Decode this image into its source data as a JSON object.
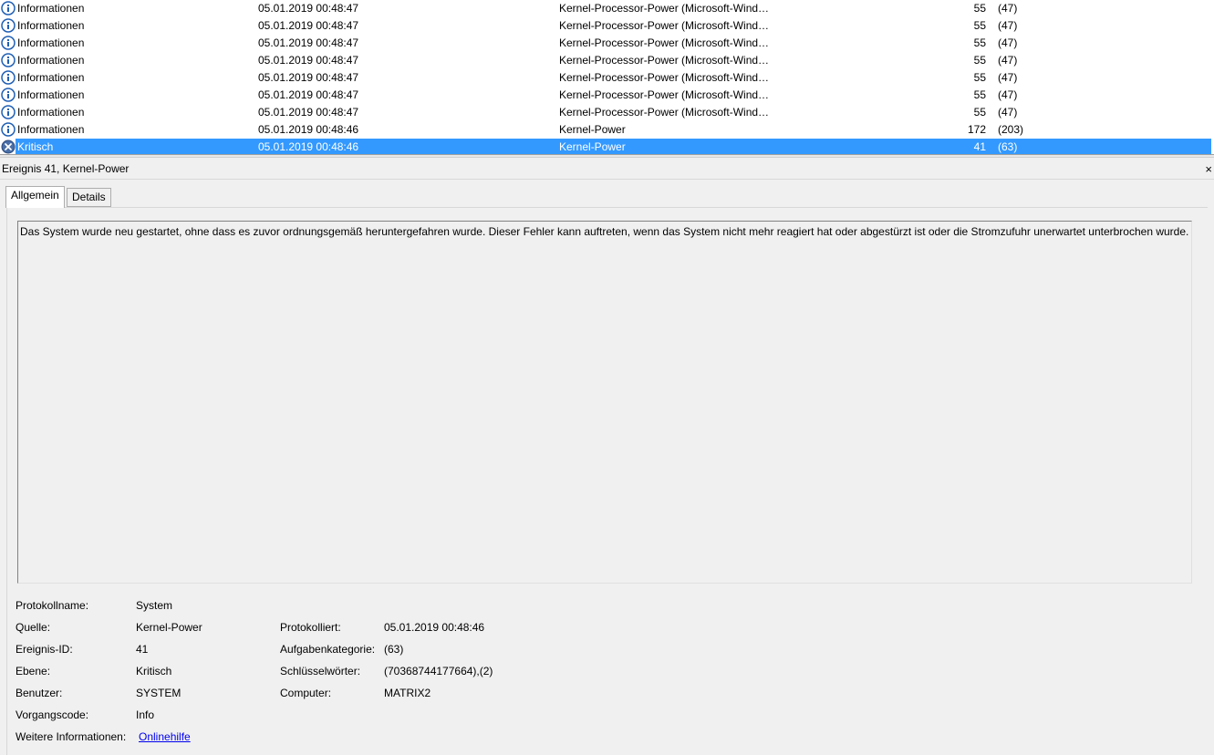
{
  "events": [
    {
      "level": "Informationen",
      "icon": "info-icon",
      "date": "05.01.2019 00:48:47",
      "source": "Kernel-Processor-Power (Microsoft-Wind…",
      "id": "55",
      "task": "(47)"
    },
    {
      "level": "Informationen",
      "icon": "info-icon",
      "date": "05.01.2019 00:48:47",
      "source": "Kernel-Processor-Power (Microsoft-Wind…",
      "id": "55",
      "task": "(47)"
    },
    {
      "level": "Informationen",
      "icon": "info-icon",
      "date": "05.01.2019 00:48:47",
      "source": "Kernel-Processor-Power (Microsoft-Wind…",
      "id": "55",
      "task": "(47)"
    },
    {
      "level": "Informationen",
      "icon": "info-icon",
      "date": "05.01.2019 00:48:47",
      "source": "Kernel-Processor-Power (Microsoft-Wind…",
      "id": "55",
      "task": "(47)"
    },
    {
      "level": "Informationen",
      "icon": "info-icon",
      "date": "05.01.2019 00:48:47",
      "source": "Kernel-Processor-Power (Microsoft-Wind…",
      "id": "55",
      "task": "(47)"
    },
    {
      "level": "Informationen",
      "icon": "info-icon",
      "date": "05.01.2019 00:48:47",
      "source": "Kernel-Processor-Power (Microsoft-Wind…",
      "id": "55",
      "task": "(47)"
    },
    {
      "level": "Informationen",
      "icon": "info-icon",
      "date": "05.01.2019 00:48:47",
      "source": "Kernel-Processor-Power (Microsoft-Wind…",
      "id": "55",
      "task": "(47)"
    },
    {
      "level": "Informationen",
      "icon": "info-icon",
      "date": "05.01.2019 00:48:46",
      "source": "Kernel-Power",
      "id": "172",
      "task": "(203)"
    },
    {
      "level": "Kritisch",
      "icon": "critical-icon",
      "date": "05.01.2019 00:48:46",
      "source": "Kernel-Power",
      "id": "41",
      "task": "(63)",
      "selected": true
    }
  ],
  "detail": {
    "title": "Ereignis 41, Kernel-Power",
    "close_glyph": "×",
    "tabs": {
      "general": "Allgemein",
      "details": "Details"
    },
    "description": "Das System wurde neu gestartet, ohne dass es zuvor ordnungsgemäß heruntergefahren wurde. Dieser Fehler kann auftreten, wenn das System nicht mehr reagiert hat oder abgestürzt ist oder die Stromzufuhr unerwartet unterbrochen wurde.",
    "props": {
      "log_name_label": "Protokollname:",
      "log_name": "System",
      "source_label": "Quelle:",
      "source": "Kernel-Power",
      "logged_label": "Protokolliert:",
      "logged": "05.01.2019 00:48:46",
      "event_id_label": "Ereignis-ID:",
      "event_id": "41",
      "task_label": "Aufgabenkategorie:",
      "task": "(63)",
      "level_label": "Ebene:",
      "level": "Kritisch",
      "keywords_label": "Schlüsselwörter:",
      "keywords": "(70368744177664),(2)",
      "user_label": "Benutzer:",
      "user": "SYSTEM",
      "computer_label": "Computer:",
      "computer": "MATRIX2",
      "opcode_label": "Vorgangscode:",
      "opcode": "Info",
      "more_info_label": "Weitere Informationen:",
      "more_info_link": "Onlinehilfe"
    }
  },
  "colors": {
    "selection": "#3399ff",
    "info_icon": "#1f5fb4",
    "critical_icon": "#4a6fa8",
    "link": "#0000ee"
  }
}
